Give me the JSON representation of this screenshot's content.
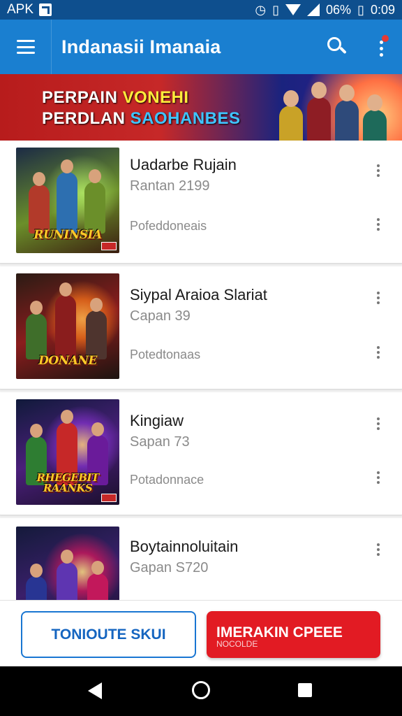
{
  "status_bar": {
    "carrier": "APK",
    "battery": "06%",
    "time": "0:09"
  },
  "app_bar": {
    "title": "Indanasii Imanaia"
  },
  "banner": {
    "line1_prefix": "PERPAIN ",
    "line1_highlight": "VONEHI",
    "line2_prefix": "PERDLAN ",
    "line2_highlight": "SAOHANBES"
  },
  "items": [
    {
      "title": "Uadarbe Rujain",
      "subtitle": "Rantan 2199",
      "meta": "Pofeddoneais",
      "thumb_text": "RUNINSIA",
      "thumb_colors": [
        "#1b2a45",
        "#6b8f2a",
        "#2d6fb0",
        "#b23a2a"
      ]
    },
    {
      "title": "Siypal Araioa Slariat",
      "subtitle": "Capan 39",
      "meta": "Potedtonaas",
      "thumb_text": "DONANE",
      "thumb_colors": [
        "#2a1b14",
        "#e86a1a",
        "#8a1d1d",
        "#3f6e2a"
      ]
    },
    {
      "title": "Kingiaw",
      "subtitle": "Sapan 73",
      "meta": "Potadonnace",
      "thumb_text": "RHEGEBIT RAANKS",
      "thumb_colors": [
        "#101a3a",
        "#7b2fbf",
        "#c62828",
        "#2e7d32"
      ]
    },
    {
      "title": "Boytainnoluitain",
      "subtitle": "Gapan S720",
      "meta": "",
      "thumb_text": "",
      "thumb_colors": [
        "#141a3a",
        "#5e35b1",
        "#c2185b",
        "#283593"
      ]
    }
  ],
  "actions": {
    "secondary_label": "TONIOUTE SKUI",
    "primary_label": "IMERAKIN CPEEE",
    "primary_sublabel": "NOCOLDE"
  },
  "colors": {
    "status_bar": "#0e4f8e",
    "app_bar": "#1a7fd0",
    "primary_button": "#e21b23",
    "outline_button": "#1976d2"
  }
}
